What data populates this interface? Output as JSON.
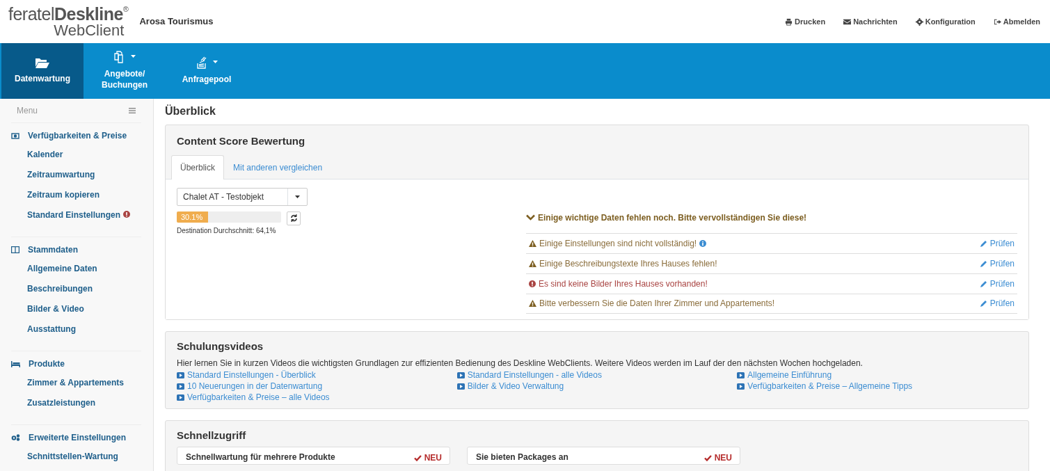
{
  "header": {
    "logo": {
      "brand_light": "feratel",
      "brand_bold": "Deskline",
      "registered": "®",
      "product": "WebClient"
    },
    "org": "Arosa Tourismus",
    "links": [
      {
        "label": "Drucken"
      },
      {
        "label": "Nachrichten"
      },
      {
        "label": "Konfiguration"
      },
      {
        "label": "Abmelden"
      }
    ]
  },
  "nav": [
    {
      "label": "Datenwartung",
      "dropdown": false,
      "selected": true
    },
    {
      "label": "Angebote/ Buchungen",
      "dropdown": true,
      "selected": false
    },
    {
      "label": "Anfragepool",
      "dropdown": true,
      "selected": false
    }
  ],
  "sidebar": {
    "menu_label": "Menu",
    "sections": [
      {
        "title": "Verfügbarkeiten & Preise",
        "items": [
          {
            "label": "Kalender",
            "alert": false
          },
          {
            "label": "Zeitraumwartung",
            "alert": false
          },
          {
            "label": "Zeitraum kopieren",
            "alert": false
          },
          {
            "label": "Standard Einstellungen",
            "alert": true
          }
        ]
      },
      {
        "title": "Stammdaten",
        "items": [
          {
            "label": "Allgemeine Daten",
            "alert": false
          },
          {
            "label": "Beschreibungen",
            "alert": false
          },
          {
            "label": "Bilder & Video",
            "alert": false
          },
          {
            "label": "Ausstattung",
            "alert": false
          }
        ]
      },
      {
        "title": "Produkte",
        "items": [
          {
            "label": "Zimmer & Appartements",
            "alert": false
          },
          {
            "label": "Zusatzleistungen",
            "alert": false
          }
        ]
      },
      {
        "title": "Erweiterte Einstellungen",
        "items": [
          {
            "label": "Schnittstellen-Wartung",
            "alert": false
          }
        ]
      }
    ]
  },
  "page_title": "Überblick",
  "content_score": {
    "title": "Content Score Bewertung",
    "tabs": [
      {
        "label": "Überblick",
        "selected": true
      },
      {
        "label": "Mit anderen vergleichen",
        "selected": false
      }
    ],
    "select": {
      "value": "Chalet AT - Testobjekt"
    },
    "score": {
      "level": 0.301,
      "reading": "30.1%"
    },
    "average": "Destination Durchschnitt: 64,1%",
    "heading": "Einige wichtige Daten fehlen noch. Bitte vervollständigen Sie diese!",
    "issues": [
      {
        "kind": "warning",
        "text": "Einige Einstellungen sind nicht vollständig!",
        "info": true,
        "action": "Prüfen"
      },
      {
        "kind": "warning",
        "text": "Einige Beschreibungstexte Ihres Hauses fehlen!",
        "info": false,
        "action": "Prüfen"
      },
      {
        "kind": "danger",
        "text": "Es sind keine Bilder Ihres Hauses vorhanden!",
        "info": false,
        "action": "Prüfen"
      },
      {
        "kind": "warning",
        "text": "Bitte verbessern Sie die Daten Ihrer Zimmer und Appartements!",
        "info": false,
        "action": "Prüfen"
      }
    ]
  },
  "videos": {
    "title": "Schulungsvideos",
    "intro": "Hier lernen Sie in kurzen Videos die wichtigsten Grundlagen zur effizienten Bedienung des Deskline WebClients. Weitere Videos werden im Lauf der den nächsten Wochen hochgeladen.",
    "links": [
      "Standard Einstellungen - Überblick",
      "Standard Einstellungen - alle Videos",
      "Allgemeine Einführung",
      "10 Neuerungen in der Datenwartung",
      "Bilder & Video Verwaltung",
      "Verfügbarkeiten & Preise – Allgemeine Tipps",
      "Verfügbarkeiten & Preise – alle Videos"
    ]
  },
  "quick_access": {
    "title": "Schnellzugriff",
    "cards": [
      {
        "title": "Schnellwartung für mehrere Produkte",
        "badge": "NEU"
      },
      {
        "title": "Sie bieten Packages an",
        "badge": "NEU"
      }
    ]
  }
}
